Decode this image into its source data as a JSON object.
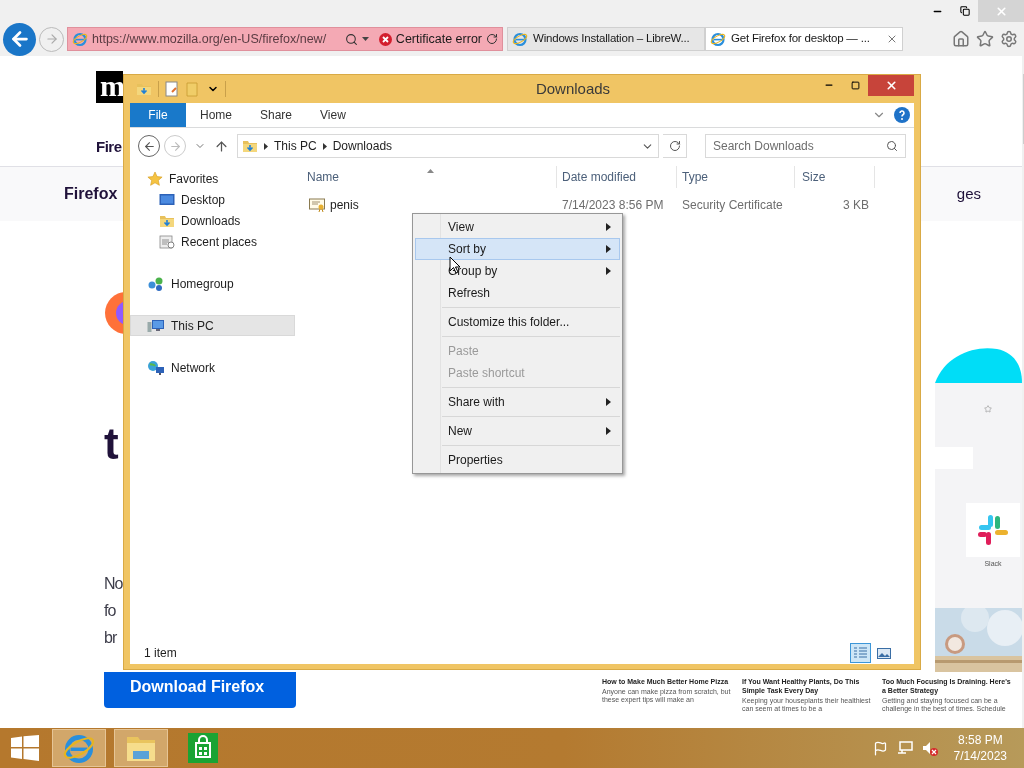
{
  "browser": {
    "address": "https://www.mozilla.org/en-US/firefox/new/",
    "certificate_label": "Certificate error",
    "tabs": [
      {
        "label": "Windows Installation – LibreW...",
        "selected": false
      },
      {
        "label": "Get Firefox for desktop — ...",
        "selected": true
      }
    ]
  },
  "web_page": {
    "logo": "m",
    "heading_fragment": "Fire",
    "nav_label": "Firefox",
    "nav_right_fragment": "ges",
    "headline_fragments": [
      "t"
    ],
    "body_fragments": [
      "No",
      "fo",
      "br"
    ],
    "download_button": "Download Firefox",
    "promo": {
      "tile_label": "Slack",
      "articles": [
        {
          "title": "How to Make Much Better Home Pizza",
          "description": "Anyone can make pizza from scratch, but these expert tips will make an"
        },
        {
          "title": "If You Want Healthy Plants, Do This Simple Task Every Day",
          "description": "Keeping your houseplants their healthiest can seem at times to be a"
        },
        {
          "title": "Too Much Focusing Is Draining. Here's a Better Strategy",
          "description": "Getting and staying focused can be a challenge in the best of times. Schedule"
        }
      ]
    }
  },
  "explorer": {
    "title": "Downloads",
    "ribbon_tabs": [
      {
        "label": "File",
        "kind": "file"
      },
      {
        "label": "Home",
        "kind": "tab"
      },
      {
        "label": "Share",
        "kind": "tab"
      },
      {
        "label": "View",
        "kind": "tab"
      }
    ],
    "breadcrumb": [
      "This PC",
      "Downloads"
    ],
    "search": {
      "placeholder": "Search Downloads"
    },
    "nav": [
      {
        "label": "Favorites",
        "kind": "favorites",
        "selected": false,
        "children": [
          {
            "label": "Desktop",
            "kind": "desktop",
            "selected": false
          },
          {
            "label": "Downloads",
            "kind": "downloads",
            "selected": false
          },
          {
            "label": "Recent places",
            "kind": "recent",
            "selected": false
          }
        ]
      },
      {
        "label": "Homegroup",
        "kind": "homegroup",
        "selected": false
      },
      {
        "label": "This PC",
        "kind": "pc",
        "selected": true
      },
      {
        "label": "Network",
        "kind": "network",
        "selected": false
      }
    ],
    "columns": [
      "Name",
      "Date modified",
      "Type",
      "Size"
    ],
    "files": [
      {
        "name": "penis",
        "date": "7/14/2023 8:56 PM",
        "type": "Security Certificate",
        "size": "3 KB"
      }
    ],
    "status": "1 item",
    "view_buttons": [
      {
        "kind": "details",
        "selected": true
      },
      {
        "kind": "thumbnails",
        "selected": false
      }
    ]
  },
  "context_menu": {
    "groups": [
      [
        {
          "label": "View",
          "submenu": true,
          "selected": false,
          "disabled": false
        },
        {
          "label": "Sort by",
          "submenu": true,
          "selected": true,
          "disabled": false
        },
        {
          "label": "Group by",
          "submenu": true,
          "selected": false,
          "disabled": false
        },
        {
          "label": "Refresh",
          "submenu": false,
          "selected": false,
          "disabled": false
        }
      ],
      [
        {
          "label": "Customize this folder...",
          "submenu": false,
          "selected": false,
          "disabled": false
        }
      ],
      [
        {
          "label": "Paste",
          "submenu": false,
          "selected": false,
          "disabled": true
        },
        {
          "label": "Paste shortcut",
          "submenu": false,
          "selected": false,
          "disabled": true
        }
      ],
      [
        {
          "label": "Share with",
          "submenu": true,
          "selected": false,
          "disabled": false
        }
      ],
      [
        {
          "label": "New",
          "submenu": true,
          "selected": false,
          "disabled": false
        }
      ],
      [
        {
          "label": "Properties",
          "submenu": false,
          "selected": false,
          "disabled": false
        }
      ]
    ]
  },
  "taskbar": {
    "apps": [
      {
        "kind": "ie",
        "open": true
      },
      {
        "kind": "explorer",
        "open": true
      },
      {
        "kind": "store",
        "open": false
      }
    ],
    "time": "8:58 PM",
    "date": "7/14/2023"
  }
}
